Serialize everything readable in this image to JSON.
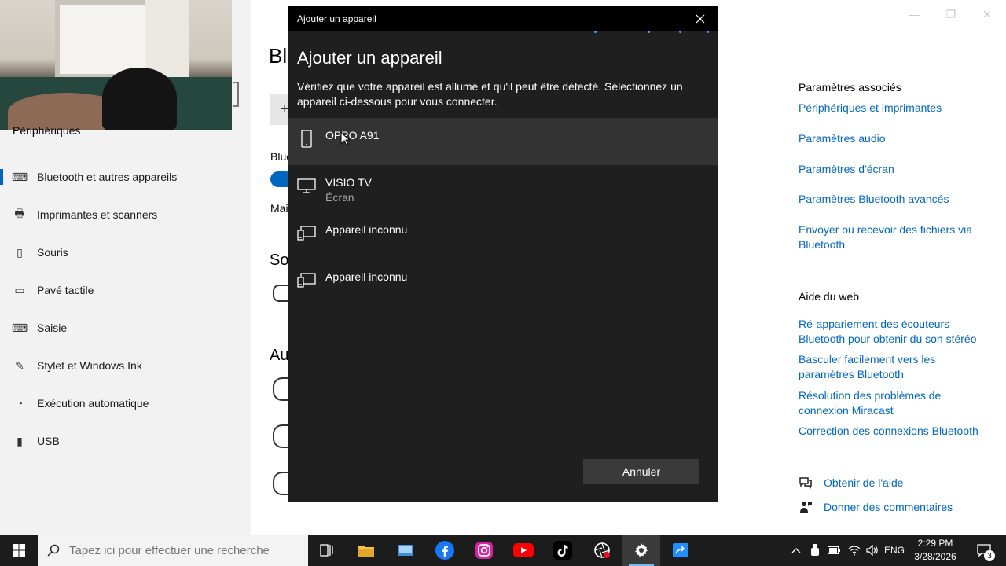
{
  "settings": {
    "sidebar": {
      "header": "Périphériques",
      "items": [
        {
          "label": "Bluetooth et autres appareils",
          "icon": "bluetooth-devices-icon",
          "active": true
        },
        {
          "label": "Imprimantes et scanners",
          "icon": "printer-icon"
        },
        {
          "label": "Souris",
          "icon": "mouse-icon"
        },
        {
          "label": "Pavé tactile",
          "icon": "touchpad-icon"
        },
        {
          "label": "Saisie",
          "icon": "keyboard-icon"
        },
        {
          "label": "Stylet et Windows Ink",
          "icon": "pen-icon"
        },
        {
          "label": "Exécution automatique",
          "icon": "autoplay-icon"
        },
        {
          "label": "USB",
          "icon": "usb-icon"
        }
      ]
    },
    "main": {
      "title_partial": "Bl",
      "bluetooth_label_partial": "Blue",
      "more_partial": "Mai",
      "section1_partial": "So",
      "section2_partial": "Au"
    },
    "related": {
      "header": "Paramètres associés",
      "links": [
        "Périphériques et imprimantes",
        "Paramètres audio",
        "Paramètres d'écran",
        "Paramètres Bluetooth avancés",
        "Envoyer ou recevoir des fichiers via Bluetooth"
      ]
    },
    "web_help": {
      "header": "Aide du web",
      "links": [
        "Ré-appariement des écouteurs Bluetooth pour obtenir du son stéréo",
        "Basculer facilement vers les paramètres Bluetooth",
        "Résolution des problèmes de connexion Miracast",
        "Correction des connexions Bluetooth"
      ]
    },
    "help": {
      "get_help": "Obtenir de l'aide",
      "feedback": "Donner des commentaires"
    }
  },
  "dialog": {
    "window_title": "Ajouter un appareil",
    "heading": "Ajouter un appareil",
    "description": "Vérifiez que votre appareil est allumé et qu'il peut être détecté. Sélectionnez un appareil ci-dessous pour vous connecter.",
    "devices": [
      {
        "name": "OPPO A91",
        "subtitle": "",
        "icon": "phone-icon",
        "selected": true
      },
      {
        "name": "VISIO TV",
        "subtitle": "Écran",
        "icon": "monitor-icon"
      },
      {
        "name": "Appareil inconnu",
        "subtitle": "",
        "icon": "unknown-device-icon"
      },
      {
        "name": "Appareil inconnu",
        "subtitle": "",
        "icon": "unknown-device-icon"
      }
    ],
    "cancel_label": "Annuler"
  },
  "taskbar": {
    "search_placeholder": "Tapez ici pour effectuer une recherche",
    "apps": [
      "task-view",
      "file-explorer",
      "control-panel",
      "facebook",
      "instagram",
      "youtube",
      "tiktok",
      "screen-recorder",
      "settings",
      "connect"
    ],
    "language": "ENG",
    "time": "2:29 PM",
    "date": "3/28/2026",
    "notifications_count": "3"
  },
  "colors": {
    "accent": "#0067c0",
    "dialog_bg": "#1f1f1f",
    "taskbar_bg": "#1c1c1c"
  }
}
